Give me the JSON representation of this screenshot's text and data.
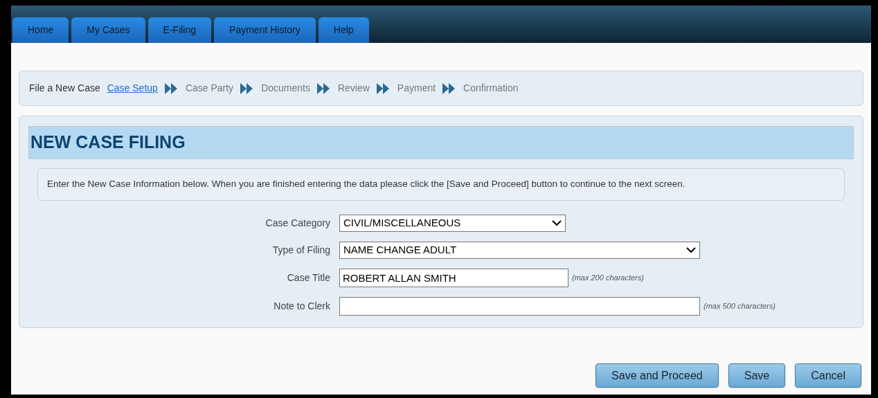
{
  "tabs": [
    {
      "label": "Home"
    },
    {
      "label": "My Cases"
    },
    {
      "label": "E-Filing"
    },
    {
      "label": "Payment History"
    },
    {
      "label": "Help"
    }
  ],
  "steps": {
    "label": "File a New Case",
    "items": [
      {
        "label": "Case Setup",
        "selected": true
      },
      {
        "label": "Case Party",
        "selected": false
      },
      {
        "label": "Documents",
        "selected": false
      },
      {
        "label": "Review",
        "selected": false
      },
      {
        "label": "Payment",
        "selected": false
      },
      {
        "label": "Confirmation",
        "selected": false
      }
    ]
  },
  "heading": "NEW CASE FILING",
  "instructions": "Enter the New Case Information below. When you are finished entering the data please click the [Save and Proceed] button to continue to the next screen.",
  "fields": [
    {
      "kind": "select",
      "label": "Case Category",
      "value": "CIVIL/MISCELLANEOUS"
    },
    {
      "kind": "select",
      "label": "Type of Filing",
      "value": "NAME CHANGE ADULT"
    },
    {
      "kind": "text",
      "label": "Case Title",
      "value": "ROBERT ALLAN SMITH",
      "hint": "(max 200 characters)"
    },
    {
      "kind": "text",
      "label": "Note to Clerk",
      "hint": "(max 500 characters)"
    }
  ],
  "buttons": [
    "Save and Proceed",
    "Save",
    "Cancel"
  ]
}
